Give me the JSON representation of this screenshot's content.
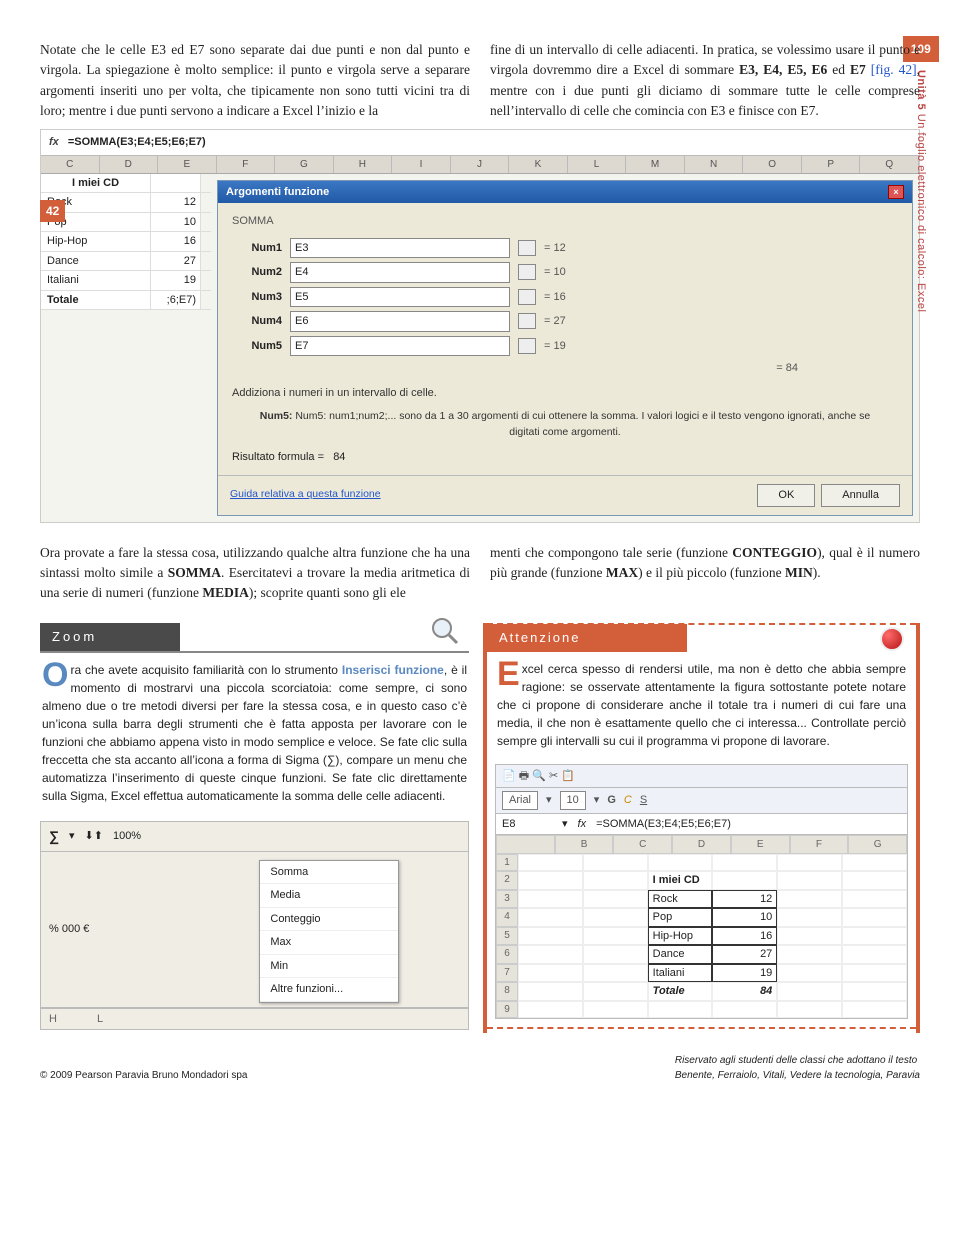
{
  "page": {
    "number": "109",
    "unit_label": "Unità 5",
    "unit_subtitle": "Un foglio elettronico di calcolo: Excel"
  },
  "intro": {
    "left": "Notate che le celle E3 ed E7 sono separate dai due punti e non dal punto e virgola. La spiegazione è molto semplice: il punto e virgola serve a separare argomenti inseriti uno per volta, che tipicamente non sono tutti vicini tra di loro; mentre i due punti servono a indicare a Excel l’inizio e la",
    "right_1": "fine di un intervallo di celle adiacenti. In pratica, se volessimo usare il punto e virgola dovremmo dire a Excel di sommare ",
    "right_bold1": "E3, E4, E5, E6",
    "right_ed": " ed ",
    "right_bold2": "E7",
    "right_fig": " [fig. 42]",
    "right_2": ", mentre con i due punti gli diciamo di sommare tutte le celle comprese nell’intervallo di celle che comincia con E3 e finisce con E7."
  },
  "fig": {
    "num": "42"
  },
  "formula": "=SOMMA(E3;E4;E5;E6;E7)",
  "sheet": {
    "cols": [
      "C",
      "D",
      "E",
      "F",
      "G",
      "H",
      "I",
      "J",
      "K",
      "L",
      "M",
      "N",
      "O",
      "P",
      "Q"
    ],
    "header": "I miei CD",
    "rows": [
      {
        "label": "Rock",
        "val": "12"
      },
      {
        "label": "Pop",
        "val": "10"
      },
      {
        "label": "Hip-Hop",
        "val": "16"
      },
      {
        "label": "Dance",
        "val": "27"
      },
      {
        "label": "Italiani",
        "val": "19"
      }
    ],
    "total_label": "Totale",
    "total_val": ";6;E7)"
  },
  "dialog": {
    "title": "Argomenti funzione",
    "fn": "SOMMA",
    "args": [
      {
        "label": "Num1",
        "val": "E3",
        "res": "= 12"
      },
      {
        "label": "Num2",
        "val": "E4",
        "res": "= 10"
      },
      {
        "label": "Num3",
        "val": "E5",
        "res": "= 16"
      },
      {
        "label": "Num4",
        "val": "E6",
        "res": "= 27"
      },
      {
        "label": "Num5",
        "val": "E7",
        "res": "= 19"
      }
    ],
    "sum_res": "= 84",
    "desc": "Addiziona i numeri in un intervallo di celle.",
    "hint": "Num5: num1;num2;... sono da 1 a 30 argomenti di cui ottenere la somma. I valori logici e il testo vengono ignorati, anche se digitati come argomenti.",
    "result_label": "Risultato formula =",
    "result_val": "84",
    "help": "Guida relativa a questa funzione",
    "ok": "OK",
    "cancel": "Annulla"
  },
  "mid": {
    "left_1": "Ora provate a fare la stessa cosa, utilizzando qualche altra funzione che ha una sintassi molto simile a ",
    "left_b1": "SOMMA",
    "left_2": ". Esercitatevi a trovare la media aritmetica di una serie di numeri (funzione ",
    "left_b2": "MEDIA",
    "left_3": "); scoprite quanti sono gli ele",
    "right_1": "menti che compongono tale serie (funzione ",
    "right_b1": "CONTEGGIO",
    "right_2": "), qual è il numero più grande (funzione ",
    "right_b2": "MAX",
    "right_3": ") e il più piccolo (funzione ",
    "right_b3": "MIN",
    "right_4": ")."
  },
  "zoom": {
    "title": "Zoom",
    "drop": "O",
    "body_1": "ra che avete acquisito familiarità con lo strumento ",
    "body_ins": "Inserisci funzione",
    "body_2": ", è il momento di mostrarvi una piccola scorciatoia: come sempre, ci sono almeno due o tre metodi diversi per fare la stessa cosa, e in questo caso c’è un’icona sulla barra degli strumenti che è fatta apposta per lavorare con le funzioni che abbiamo appena visto in modo semplice e veloce. Se fate clic sulla freccetta che sta accanto all’icona a forma di Sigma (∑), compare un menu che automatizza l’inserimento di queste cinque funzioni. Se fate clic direttamente sulla Sigma, Excel effettua automaticamente la somma delle celle adiacenti.",
    "toolbar_pct": "100%",
    "toolbar_syms": "% 000 €",
    "menu": [
      "Somma",
      "Media",
      "Conteggio",
      "Max",
      "Min",
      "Altre funzioni..."
    ],
    "colH": "H",
    "colL": "L"
  },
  "att": {
    "title": "Attenzione",
    "drop": "E",
    "body": "xcel cerca spesso di rendersi utile, ma non è detto che abbia sempre ragione: se osservate attentamente la figura sottostante potete notare che ci propone di considerare anche il totale tra i numeri di cui fare una media, il che non è esattamente quello che ci interessa... Controllate perciò sempre gli intervalli su cui il programma vi propone di lavorare.",
    "font": "Arial",
    "size": "10",
    "cellref": "E8",
    "formula": "=SOMMA(E3;E4;E5;E6;E7)",
    "cols": [
      "",
      "B",
      "C",
      "D",
      "E",
      "F",
      "G"
    ],
    "rows": [
      {
        "n": "1",
        "vals": [
          "",
          "",
          "",
          "",
          "",
          ""
        ]
      },
      {
        "n": "2",
        "vals": [
          "",
          "",
          "I miei CD",
          "",
          "",
          ""
        ]
      },
      {
        "n": "3",
        "vals": [
          "",
          "",
          "Rock",
          "12",
          "",
          ""
        ]
      },
      {
        "n": "4",
        "vals": [
          "",
          "",
          "Pop",
          "10",
          "",
          ""
        ]
      },
      {
        "n": "5",
        "vals": [
          "",
          "",
          "Hip-Hop",
          "16",
          "",
          ""
        ]
      },
      {
        "n": "6",
        "vals": [
          "",
          "",
          "Dance",
          "27",
          "",
          ""
        ]
      },
      {
        "n": "7",
        "vals": [
          "",
          "",
          "Italiani",
          "19",
          "",
          ""
        ]
      },
      {
        "n": "8",
        "vals": [
          "",
          "",
          "Totale",
          "84",
          "",
          ""
        ]
      },
      {
        "n": "9",
        "vals": [
          "",
          "",
          "",
          "",
          "",
          ""
        ]
      }
    ]
  },
  "footer": {
    "left": "© 2009 Pearson Paravia Bruno Mondadori spa",
    "right1": "Riservato agli studenti delle classi che adottano il testo",
    "right2": "Benente, Ferraiolo, Vitali, Vedere la tecnologia, Paravia"
  }
}
